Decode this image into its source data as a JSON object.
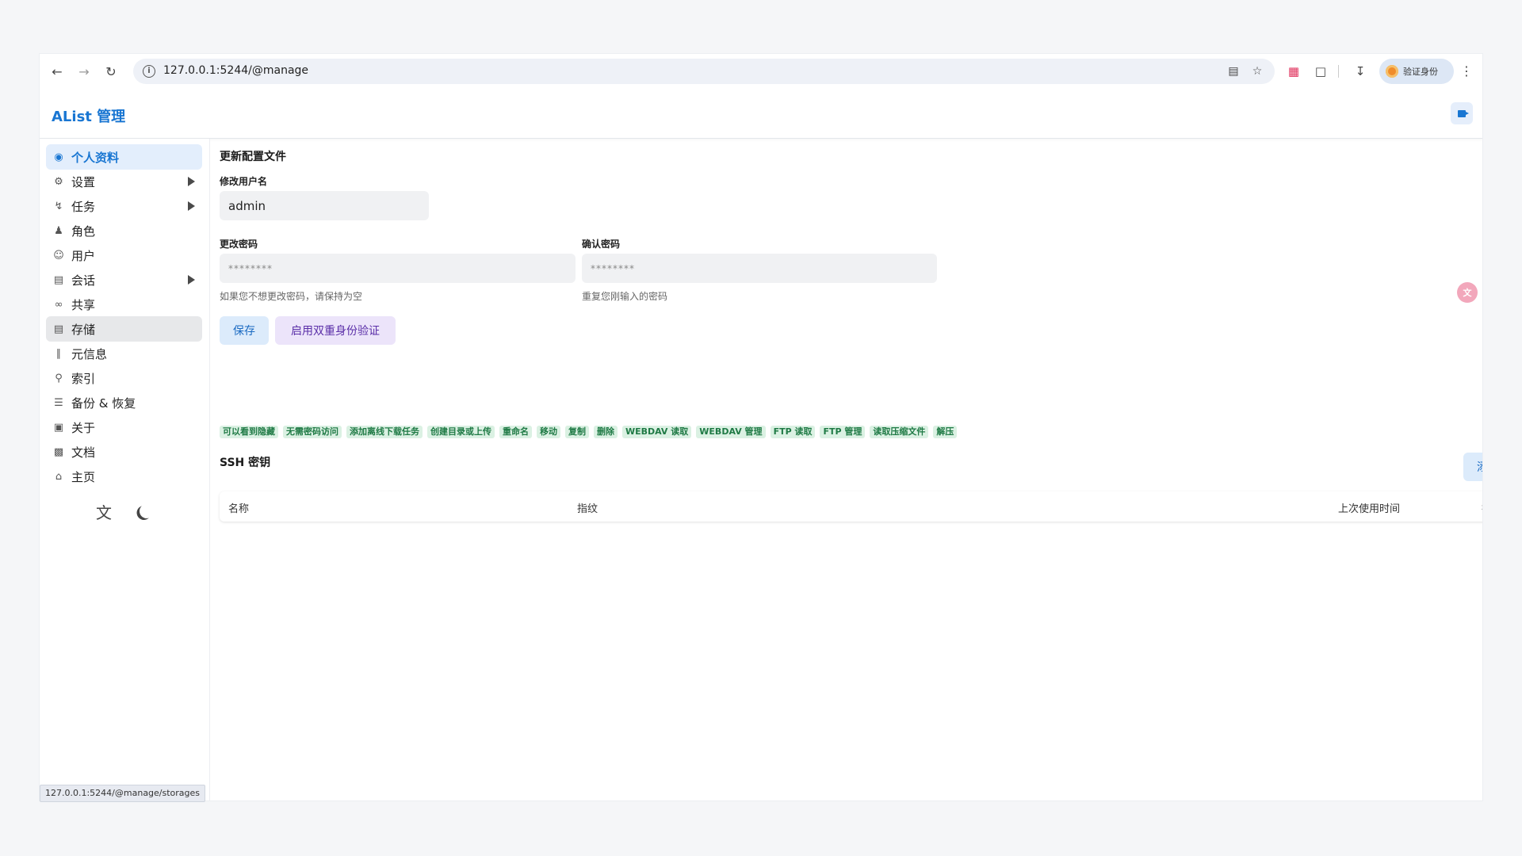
{
  "browser": {
    "url": "127.0.0.1:5244/@manage",
    "profile_label": "验证身份",
    "status_url": "127.0.0.1:5244/@manage/storages"
  },
  "app": {
    "title": "AList 管理"
  },
  "sidebar": {
    "items": [
      {
        "label": "个人资料",
        "icon": "profile-icon",
        "state": "active",
        "has_submenu": false
      },
      {
        "label": "设置",
        "icon": "gear-icon",
        "has_submenu": true
      },
      {
        "label": "任务",
        "icon": "tasks-icon",
        "has_submenu": true
      },
      {
        "label": "角色",
        "icon": "role-icon",
        "has_submenu": false
      },
      {
        "label": "用户",
        "icon": "user-icon",
        "has_submenu": false
      },
      {
        "label": "会话",
        "icon": "session-icon",
        "has_submenu": true
      },
      {
        "label": "共享",
        "icon": "link-icon",
        "has_submenu": false
      },
      {
        "label": "存储",
        "icon": "storage-icon",
        "state": "hover",
        "has_submenu": false
      },
      {
        "label": "元信息",
        "icon": "meta-icon",
        "has_submenu": false
      },
      {
        "label": "索引",
        "icon": "search-icon",
        "has_submenu": false
      },
      {
        "label": "备份 & 恢复",
        "icon": "database-icon",
        "has_submenu": false
      },
      {
        "label": "关于",
        "icon": "about-icon",
        "has_submenu": false
      },
      {
        "label": "文档",
        "icon": "book-icon",
        "has_submenu": false
      },
      {
        "label": "主页",
        "icon": "home-icon",
        "has_submenu": false
      }
    ]
  },
  "profile": {
    "section_title": "更新配置文件",
    "username_label": "修改用户名",
    "username_value": "admin",
    "password_label": "更改密码",
    "password_placeholder": "********",
    "password_hint": "如果您不想更改密码，请保持为空",
    "confirm_label": "确认密码",
    "confirm_placeholder": "********",
    "confirm_hint": "重复您刚输入的密码",
    "save_button": "保存",
    "twofa_button": "启用双重身份验证"
  },
  "permissions": [
    "可以看到隐藏",
    "无需密码访问",
    "添加离线下载任务",
    "创建目录或上传",
    "重命名",
    "移动",
    "复制",
    "删除",
    "WEBDAV 读取",
    "WEBDAV 管理",
    "FTP 读取",
    "FTP 管理",
    "读取压缩文件",
    "解压"
  ],
  "ssh": {
    "title": "SSH 密钥",
    "add_button": "添加",
    "columns": {
      "name": "名称",
      "fingerprint": "指纹",
      "last_used": "上次使用时间",
      "actions": "操作"
    }
  },
  "colors": {
    "accent": "#1976d2",
    "perm_bg": "#dbf1e3",
    "perm_text": "#1f7a45"
  }
}
